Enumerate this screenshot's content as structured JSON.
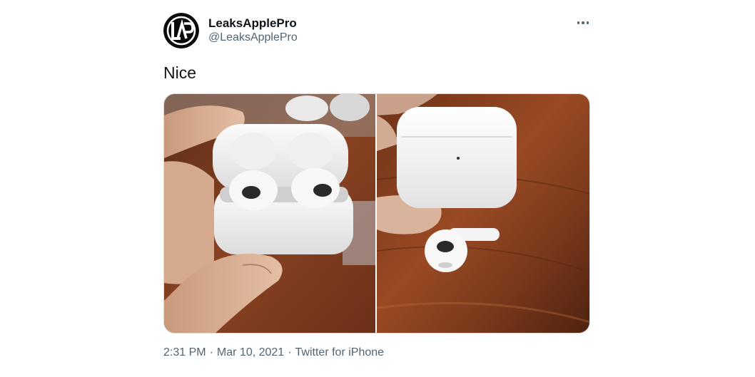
{
  "author": {
    "display_name": "LeaksApplePro",
    "handle": "@LeaksApplePro",
    "avatar_icon": "lap-logo-avatar-icon"
  },
  "more_icon": "more-horizontal-icon",
  "tweet": {
    "text": "Nice"
  },
  "media": {
    "photos": [
      {
        "name": "photo-airpods-open-case",
        "description_icon": "airpods-open-case-image"
      },
      {
        "name": "photo-airpods-closed-case",
        "description_icon": "airpods-closed-case-image"
      }
    ]
  },
  "meta": {
    "time": "2:31 PM",
    "separator": "·",
    "date": "Mar 10, 2021",
    "source": "Twitter for iPhone"
  },
  "colors": {
    "primary_text": "#0f1419",
    "secondary_text": "#536471",
    "wood": "#7a3c1f"
  }
}
